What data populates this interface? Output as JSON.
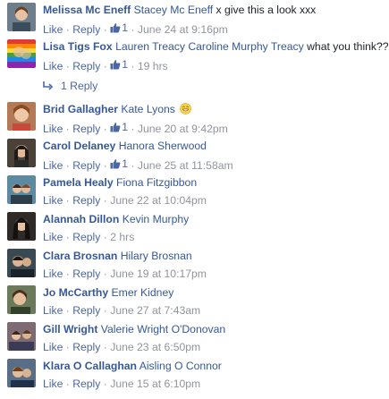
{
  "actions": {
    "like": "Like",
    "reply": "Reply",
    "sep": "·"
  },
  "comments": [
    {
      "author": "Melissa Mc Eneff",
      "mention": "Stacey Mc Eneff",
      "text": " x give this a look xxx",
      "likes": "1",
      "time": "June 24 at 9:16pm",
      "avatar_color": "#6d7f8c"
    },
    {
      "author": "Lisa Tigs Fox",
      "mention": "Lauren Treacy Caroline Murphy Treacy",
      "text": " what you think??",
      "likes": "1",
      "time": "19 hrs",
      "avatar_color": "#c25a94"
    },
    {
      "author": "Brid Gallagher",
      "mention": "Kate Lyons",
      "text": "",
      "emoji": "grinning-face",
      "likes": "1",
      "time": "June 20 at 9:42pm",
      "avatar_color": "#b27a55"
    },
    {
      "author": "Carol Delaney",
      "mention": "Hanora Sherwood",
      "text": "",
      "likes": "1",
      "time": "June 25 at 11:58am",
      "avatar_color": "#4a4139"
    },
    {
      "author": "Pamela Healy",
      "mention": "Fiona Fitzgibbon",
      "text": "",
      "likes": "",
      "time": "June 22 at 10:04pm",
      "avatar_color": "#5d8aa0"
    },
    {
      "author": "Alannah Dillon",
      "mention": "Kevin Murphy",
      "text": "",
      "likes": "",
      "time": "2 hrs",
      "avatar_color": "#2f2a28"
    },
    {
      "author": "Clara Brosnan",
      "mention": "Hilary Brosnan",
      "text": "",
      "likes": "",
      "time": "June 19 at 10:17pm",
      "avatar_color": "#3a4a52"
    },
    {
      "author": "Jo McCarthy",
      "mention": "Emer Kidney",
      "text": "",
      "likes": "",
      "time": "June 27 at 7:43am",
      "avatar_color": "#6a7a5a"
    },
    {
      "author": "Gill Wright",
      "mention": "Valerie Wright O'Donovan",
      "text": "",
      "likes": "",
      "time": "June 23 at 6:50pm",
      "avatar_color": "#7d6a73"
    },
    {
      "author": "Klara O Callaghan",
      "mention": "Aisling O Connor",
      "text": "",
      "likes": "",
      "time": "June 15 at 6:10pm",
      "avatar_color": "#5a6d86"
    }
  ],
  "replies_link": "1 Reply"
}
